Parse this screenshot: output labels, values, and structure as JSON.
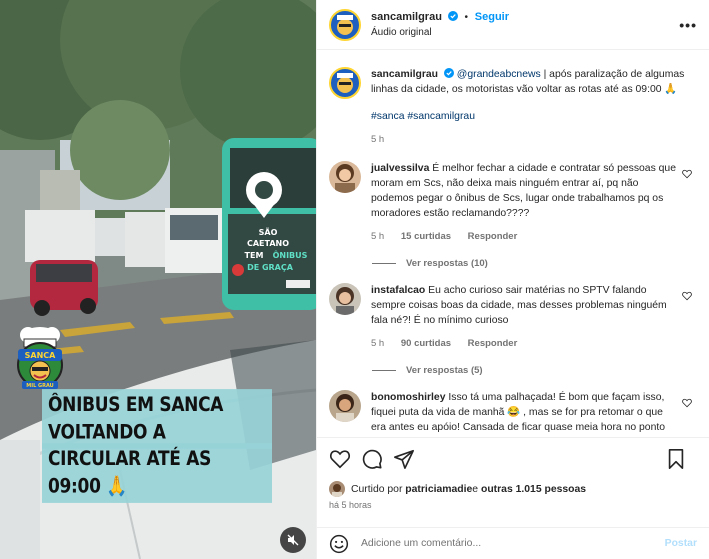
{
  "header": {
    "username": "sancamilgrau",
    "follow_label": "Seguir",
    "separator": "•",
    "audio": "Áudio original",
    "more": "•••"
  },
  "media": {
    "caption_lines": [
      "ÔNIBUS EM SANCA VOLTANDO A",
      "CIRCULAR ATÉ AS 09:00 🙏"
    ],
    "bus_text": [
      "SÃO",
      "CAETANO",
      "TEM",
      "ÔNIBUS",
      "DE GRAÇA"
    ],
    "badge_text": [
      "SANCA",
      "MIL GRAU"
    ]
  },
  "post": {
    "username": "sancamilgrau",
    "mention": "@grandeabcnews",
    "text": " | após paralização de algumas linhas da cidade, os motoristas vão voltar as rotas até as 09:00 🙏",
    "tags": "#sanca #sancamilgrau",
    "time": "5 h"
  },
  "comments": [
    {
      "username": "jualvessilva",
      "text": " É melhor fechar a cidade e contratar só pessoas que moram em Scs, não deixa mais ninguém entrar aí, pq não podemos pegar o ônibus de Scs, lugar onde trabalhamos pq os moradores estão reclamando????",
      "time": "5 h",
      "likes": "15 curtidas",
      "reply": "Responder",
      "replies": "Ver respostas (10)"
    },
    {
      "username": "instafalcao",
      "text": " Eu acho curioso sair matérias no SPTV falando sempre coisas boas da cidade, mas desses problemas ninguém fala né?! É no mínimo curioso",
      "time": "5 h",
      "likes": "90 curtidas",
      "reply": "Responder",
      "replies": "Ver respostas (5)"
    },
    {
      "username": "bonomoshirley",
      "text": " Isso tá uma palhaçada! É bom que façam isso, fiquei puta da vida de manhã 😂 , mas se for pra retomar o que era antes eu apóio! Cansada de ficar quase meia hora no ponto",
      "time": "",
      "likes": "",
      "reply": "",
      "replies": ""
    }
  ],
  "likes": {
    "prefix": "Curtido por ",
    "user": "patriciamadie",
    "middle": " e ",
    "others": "outras 1.015 pessoas"
  },
  "time_ago": "há 5 horas",
  "add_comment": {
    "placeholder": "Adicione um comentário...",
    "post_label": "Postar"
  },
  "colors": {
    "accent": "#0095f6",
    "link": "#00376b",
    "muted": "#737373",
    "caption_bg": "#96d2d7",
    "bus_teal": "#3fbfa6"
  }
}
